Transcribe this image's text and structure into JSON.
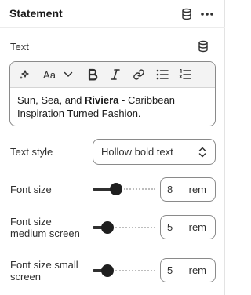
{
  "header": {
    "title": "Statement"
  },
  "text_setting": {
    "label": "Text",
    "toolbar": [
      {
        "name": "ai-sparkle-icon"
      },
      {
        "name": "font-size-icon",
        "text": "Aa"
      },
      {
        "name": "chevron-down-icon"
      },
      {
        "name": "bold-icon"
      },
      {
        "name": "italic-icon"
      },
      {
        "name": "link-icon"
      },
      {
        "name": "bullet-list-icon"
      },
      {
        "name": "numbered-list-icon"
      }
    ],
    "content_before": "Sun, Sea, and ",
    "content_bold": "Riviera",
    "content_after": " - Caribbean Inspiration Turned Fashion."
  },
  "text_style": {
    "label": "Text style",
    "value": "Hollow bold text"
  },
  "font_size": {
    "label": "Font size",
    "value": "8",
    "unit": "rem",
    "level": 0.38
  },
  "font_size_medium": {
    "label": "Font size medium screen",
    "value": "5",
    "unit": "rem",
    "level": 0.24
  },
  "font_size_small": {
    "label": "Font size small screen",
    "value": "5",
    "unit": "rem",
    "level": 0.24
  },
  "colors": {
    "border": "#8a8a8a",
    "text": "#303030",
    "toolbar_bg": "#f3f3f3"
  }
}
